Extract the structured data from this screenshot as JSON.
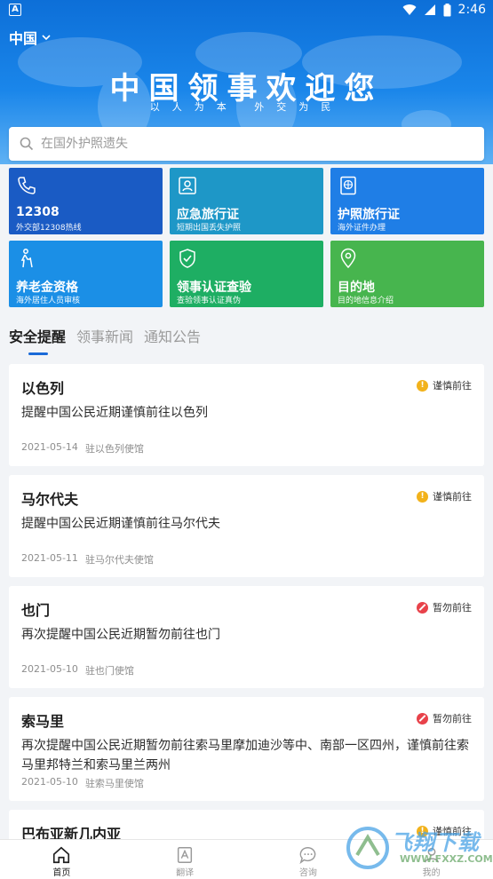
{
  "status_bar": {
    "time": "2:46",
    "left_icon": "A"
  },
  "header": {
    "country": "中国",
    "banner_title": "中国领事欢迎您",
    "banner_subtitle": "以人为本 外交为民"
  },
  "search": {
    "placeholder": "在国外护照遗失"
  },
  "tiles": [
    {
      "label": "12308",
      "sub": "外交部12308热线",
      "icon": "phone-icon",
      "color": "#1a5bc4"
    },
    {
      "label": "应急旅行证",
      "sub": "短期出国丢失护照",
      "icon": "id-card-icon",
      "color": "#1e97c7"
    },
    {
      "label": "护照旅行证",
      "sub": "海外证件办理",
      "icon": "passport-icon",
      "color": "#1f7ee6"
    },
    {
      "label": "养老金资格",
      "sub": "海外居住人员审核",
      "icon": "elder-icon",
      "color": "#1b8fe6"
    },
    {
      "label": "领事认证查验",
      "sub": "查验领事认证真伪",
      "icon": "shield-check-icon",
      "color": "#1eae63"
    },
    {
      "label": "目的地",
      "sub": "目的地信息介绍",
      "icon": "location-pin-icon",
      "color": "#47b54e"
    }
  ],
  "tabs": [
    "安全提醒",
    "领事新闻",
    "通知公告"
  ],
  "cards": [
    {
      "title": "以色列",
      "badge": "谨慎前往",
      "level": "caution",
      "desc": "提醒中国公民近期谨慎前往以色列",
      "date": "2021-05-14",
      "source": "驻以色列使馆"
    },
    {
      "title": "马尔代夫",
      "badge": "谨慎前往",
      "level": "caution",
      "desc": "提醒中国公民近期谨慎前往马尔代夫",
      "date": "2021-05-11",
      "source": "驻马尔代夫使馆"
    },
    {
      "title": "也门",
      "badge": "暂勿前往",
      "level": "stop",
      "desc": "再次提醒中国公民近期暂勿前往也门",
      "date": "2021-05-10",
      "source": "驻也门使馆"
    },
    {
      "title": "索马里",
      "badge": "暂勿前往",
      "level": "stop",
      "desc": "再次提醒中国公民近期暂勿前往索马里摩加迪沙等中、南部一区四州，谨慎前往索马里邦特兰和索马里兰两州",
      "date": "2021-05-10",
      "source": "驻索马里使馆"
    },
    {
      "title": "巴布亚新几内亚",
      "badge": "谨慎前往",
      "level": "caution",
      "desc": "",
      "date": "",
      "source": ""
    }
  ],
  "bottom_nav": [
    {
      "label": "首页",
      "icon": "home-icon",
      "active": true
    },
    {
      "label": "翻译",
      "icon": "translate-icon",
      "active": false
    },
    {
      "label": "咨询",
      "icon": "chat-icon",
      "active": false
    },
    {
      "label": "我的",
      "icon": "profile-icon",
      "active": false
    }
  ],
  "watermark": {
    "brand": "飞翔下载",
    "url": "WWW.FXXZ.COM"
  }
}
